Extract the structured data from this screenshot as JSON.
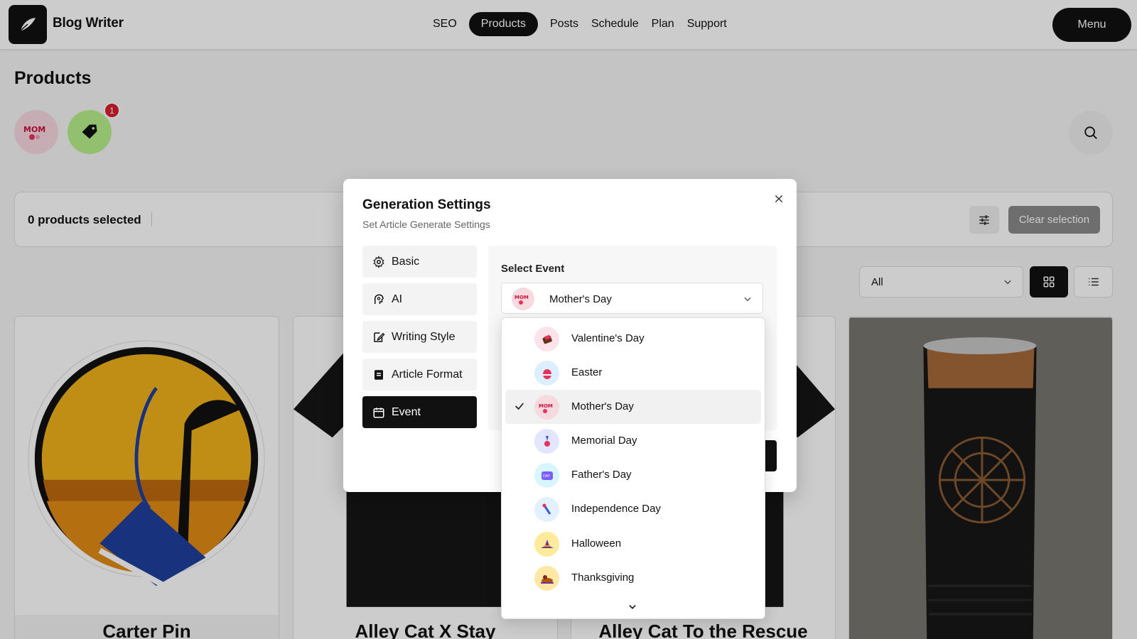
{
  "app": {
    "title": "Blog Writer"
  },
  "nav": {
    "items": [
      {
        "label": "SEO",
        "active": false
      },
      {
        "label": "Products",
        "active": true
      },
      {
        "label": "Posts",
        "active": false
      },
      {
        "label": "Schedule",
        "active": false
      },
      {
        "label": "Plan",
        "active": false
      },
      {
        "label": "Support",
        "active": false
      }
    ],
    "menu_label": "Menu"
  },
  "page": {
    "title": "Products",
    "tag_badge_count": "1",
    "selection": {
      "count_text": "0 products selected",
      "clear_label": "Clear selection"
    },
    "filter": {
      "selected": "All"
    },
    "cards": [
      {
        "title": "Carter Pin"
      },
      {
        "title": "Alley Cat X Stay"
      },
      {
        "title": "Alley Cat To the Rescue"
      },
      {
        "title": ""
      }
    ]
  },
  "modal": {
    "title": "Generation Settings",
    "subtitle": "Set Article Generate Settings",
    "tabs": [
      {
        "label": "Basic",
        "icon": "gear-icon",
        "active": false
      },
      {
        "label": "AI",
        "icon": "ai-icon",
        "active": false
      },
      {
        "label": "Writing Style",
        "icon": "edit-icon",
        "active": false
      },
      {
        "label": "Article Format",
        "icon": "document-icon",
        "active": false
      },
      {
        "label": "Event",
        "icon": "calendar-icon",
        "active": true
      }
    ],
    "event": {
      "label": "Select Event",
      "selected": "Mother's Day",
      "options": [
        {
          "label": "Valentine's Day",
          "icon": "chocolate-icon",
          "color": "#fbe3ea",
          "selected": false
        },
        {
          "label": "Easter",
          "icon": "easter-egg-icon",
          "color": "#dcefff",
          "selected": false
        },
        {
          "label": "Mother's Day",
          "icon": "mom-icon",
          "color": "#f7d9e0",
          "selected": true
        },
        {
          "label": "Memorial Day",
          "icon": "medal-icon",
          "color": "#e3e6ff",
          "selected": false
        },
        {
          "label": "Father's Day",
          "icon": "dad-icon",
          "color": "#d7f6ff",
          "selected": false
        },
        {
          "label": "Independence Day",
          "icon": "firework-icon",
          "color": "#e2f0ff",
          "selected": false
        },
        {
          "label": "Halloween",
          "icon": "witch-hat-icon",
          "color": "#fdeb9c",
          "selected": false
        },
        {
          "label": "Thanksgiving",
          "icon": "turkey-icon",
          "color": "#ffe7a6",
          "selected": false
        }
      ]
    }
  }
}
